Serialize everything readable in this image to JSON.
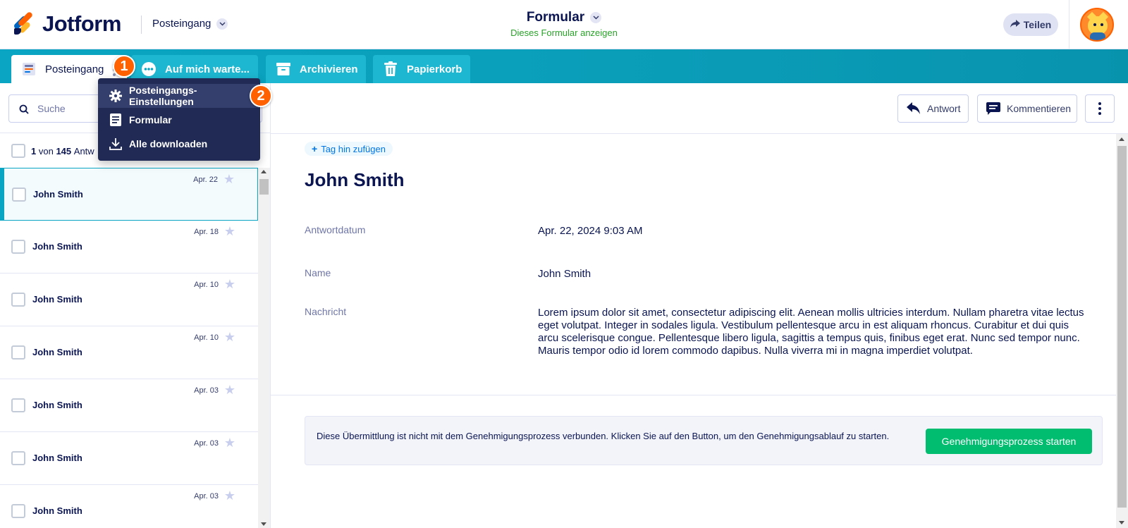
{
  "header": {
    "brand": "Jotform",
    "inbox_selector": "Posteingang",
    "form_title": "Formular",
    "form_link": "Dieses Formular anzeigen",
    "share_label": "Teilen"
  },
  "tabs": [
    {
      "label": "Posteingang",
      "icon": "inbox-icon",
      "active": true
    },
    {
      "label": "Auf mich warte...",
      "icon": "ellipsis-circle-icon",
      "active": false
    },
    {
      "label": "Archivieren",
      "icon": "archive-icon",
      "active": false
    },
    {
      "label": "Papierkorb",
      "icon": "trash-icon",
      "active": false
    }
  ],
  "step_badges": [
    "1",
    "2"
  ],
  "dropdown": {
    "items": [
      {
        "label": "Posteingangs-Einstellungen",
        "icon": "gear-icon"
      },
      {
        "label": "Formular",
        "icon": "document-icon"
      },
      {
        "label": "Alle downloaden",
        "icon": "download-icon"
      }
    ]
  },
  "left": {
    "search_placeholder": "Suche",
    "count": {
      "current": "1",
      "word_of": "von",
      "total": "145",
      "suffix": "Antw"
    }
  },
  "submissions": [
    {
      "name": "John Smith",
      "date": "Apr. 22",
      "selected": true
    },
    {
      "name": "John Smith",
      "date": "Apr. 18",
      "selected": false
    },
    {
      "name": "John Smith",
      "date": "Apr. 10",
      "selected": false
    },
    {
      "name": "John Smith",
      "date": "Apr. 10",
      "selected": false
    },
    {
      "name": "John Smith",
      "date": "Apr. 03",
      "selected": false
    },
    {
      "name": "John Smith",
      "date": "Apr. 03",
      "selected": false
    },
    {
      "name": "John Smith",
      "date": "Apr. 03",
      "selected": false
    }
  ],
  "toolbar": {
    "reply_label": "Antwort",
    "comment_label": "Kommentieren"
  },
  "detail": {
    "add_tag": "Tag hin zufügen",
    "name_heading": "John Smith",
    "fields": {
      "date_label": "Antwortdatum",
      "date_value": "Apr. 22, 2024 9:03 AM",
      "name_label": "Name",
      "name_value": "John Smith",
      "message_label": "Nachricht",
      "message_value": "Lorem ipsum dolor sit amet, consectetur adipiscing elit. Aenean mollis ultricies interdum. Nullam pharetra vitae lectus eget volutpat. Integer in sodales ligula. Vestibulum pellentesque arcu in est aliquam rhoncus. Curabitur et dui quis arcu scelerisque congue. Pellentesque libero ligula, sagittis a tempus quis, finibus eget erat. Nunc sed tempor nunc. Mauris tempor odio id lorem commodo dapibus. Nulla viverra mi in magna imperdiet volutpat."
    },
    "approval_message": "Diese Übermittlung ist nicht mit dem Genehmigungsprozess verbunden. Klicken Sie auf den Button, um den Genehmigungsablauf zu starten.",
    "approval_button": "Genehmigungsprozess starten"
  },
  "colors": {
    "brand_navy": "#0a1551",
    "teal": "#0aa5c2",
    "orange": "#ff6100",
    "green": "#01bd6f",
    "dropdown_bg": "#202a54"
  }
}
